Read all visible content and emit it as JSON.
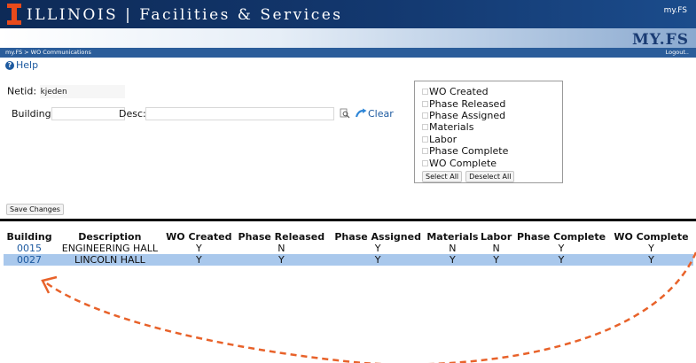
{
  "header": {
    "site_title": "ILLINOIS | Facilities & Services",
    "myfs_link": "my.FS",
    "brand": "MY.FS"
  },
  "breadcrumb": {
    "path": "my.FS > WO Communications",
    "logout": "Logout.."
  },
  "help": {
    "label": "Help"
  },
  "form": {
    "netid_label": "Netid:",
    "netid_value": "kjeden",
    "building_label": "Building:",
    "building_value": "",
    "desc_label": "Desc:",
    "desc_value": "",
    "clear_label": "Clear",
    "save_label": "Save Changes"
  },
  "filters": {
    "options": [
      "WO Created",
      "Phase Released",
      "Phase Assigned",
      "Materials",
      "Labor",
      "Phase Complete",
      "WO Complete"
    ],
    "select_all": "Select All",
    "deselect_all": "Deselect All"
  },
  "table": {
    "columns": [
      "Building",
      "Description",
      "WO Created",
      "Phase Released",
      "Phase Assigned",
      "Materials",
      "Labor",
      "Phase Complete",
      "WO Complete"
    ],
    "rows": [
      [
        "0015",
        "ENGINEERING HALL",
        "Y",
        "N",
        "Y",
        "N",
        "N",
        "Y",
        "Y"
      ],
      [
        "0027",
        "LINCOLN HALL",
        "Y",
        "Y",
        "Y",
        "Y",
        "Y",
        "Y",
        "Y"
      ]
    ],
    "selected_row": 1
  },
  "colors": {
    "header_navy": "#13386f",
    "logo_orange": "#e84a1b",
    "link_blue": "#1d5aa0",
    "selected_row": "#a9c8ec",
    "annotation_arrow": "#e8622a"
  }
}
